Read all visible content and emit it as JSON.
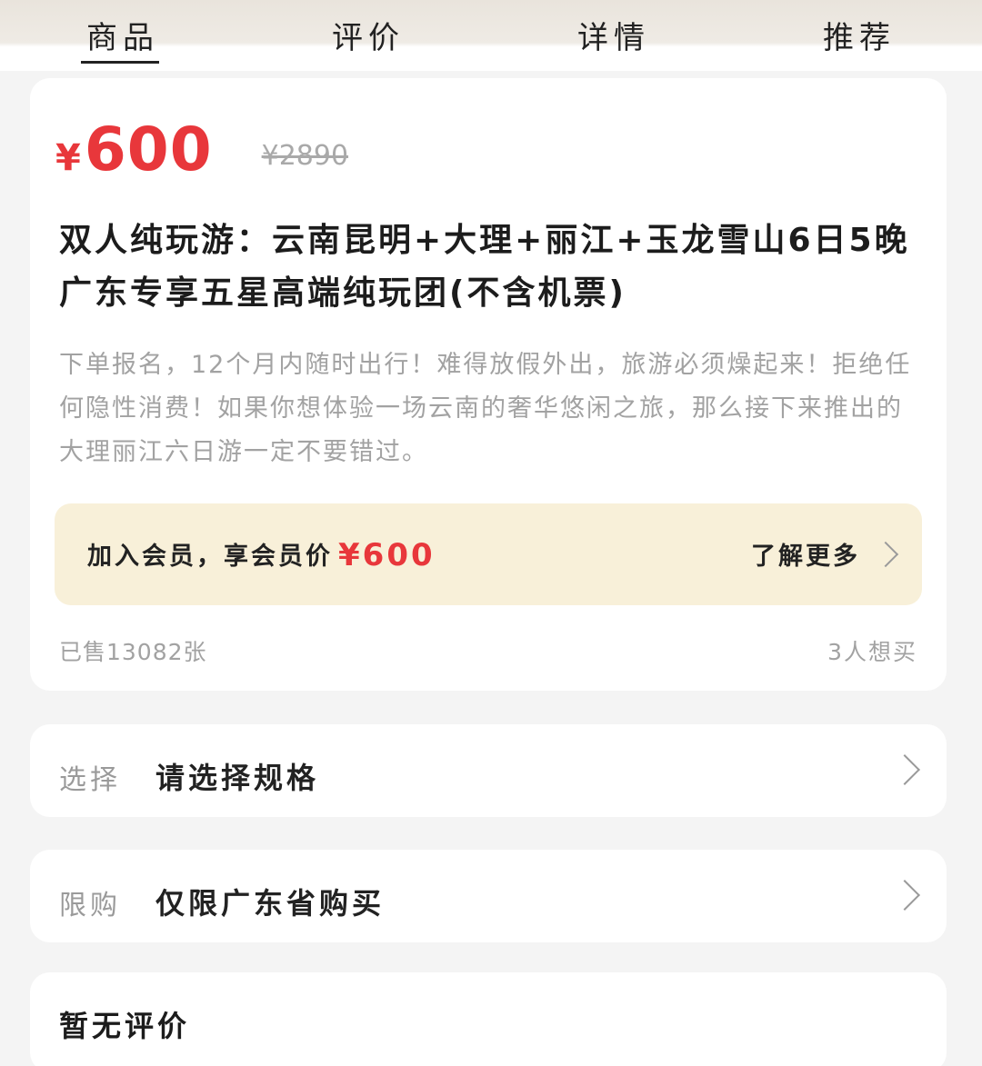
{
  "tabs": [
    {
      "label": "商品",
      "active": true
    },
    {
      "label": "评价",
      "active": false
    },
    {
      "label": "详情",
      "active": false
    },
    {
      "label": "推荐",
      "active": false
    }
  ],
  "product": {
    "currency": "¥",
    "price": "600",
    "original_price": "¥2890",
    "title": "双人纯玩游：云南昆明+大理+丽江+玉龙雪山6日5晚 广东专享五星高端纯玩团(不含机票)",
    "description": "下单报名，12个月内随时出行！难得放假外出，旅游必须燥起来！拒绝任何隐性消费！如果你想体验一场云南的奢华悠闲之旅，那么接下来推出的大理丽江六日游一定不要错过。",
    "sold": "已售13082张",
    "want": "3人想买"
  },
  "member": {
    "text": "加入会员，享会员价",
    "price": "¥600",
    "more": "了解更多"
  },
  "options": {
    "select_label": "选择",
    "select_value": "请选择规格",
    "limit_label": "限购",
    "limit_value": "仅限广东省购买"
  },
  "reviews": {
    "empty": "暂无评价"
  },
  "colors": {
    "accent_red": "#e8373b",
    "member_bg": "#f8f0d9"
  }
}
